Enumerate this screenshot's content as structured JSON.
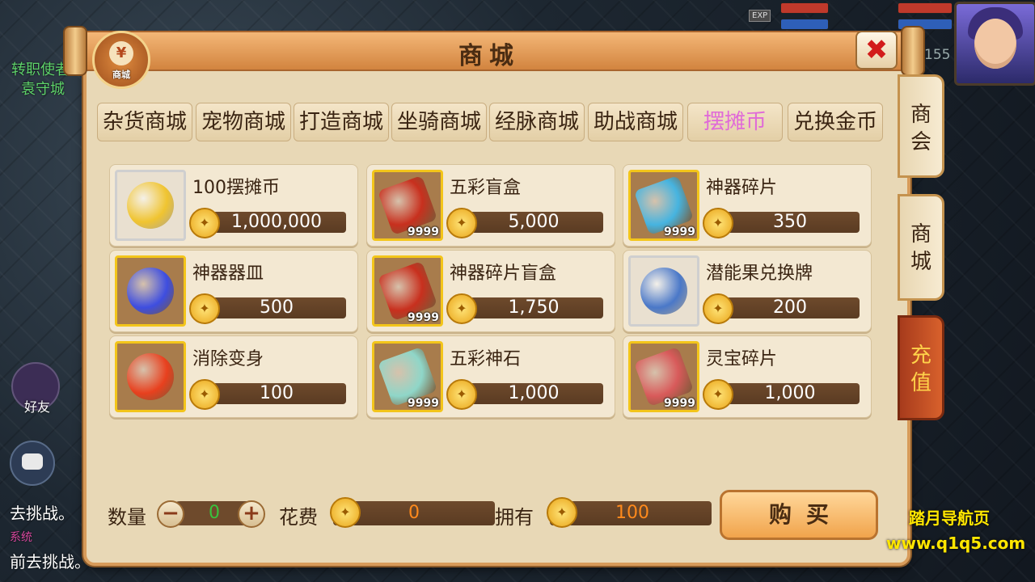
{
  "background": {
    "npc_title": "转职使者",
    "npc_place": "袁守城",
    "level": "155",
    "exp_label": "EXP",
    "friends_label": "好友",
    "chat_lines": [
      "去挑战。",
      "系统",
      "前去挑战。"
    ]
  },
  "shop": {
    "title": "商城",
    "logo_label": "商城",
    "logo_symbol": "¥",
    "close_symbol": "✖"
  },
  "tabs": [
    {
      "label": "杂货商城"
    },
    {
      "label": "宠物商城"
    },
    {
      "label": "打造商城"
    },
    {
      "label": "坐骑商城"
    },
    {
      "label": "经脉商城"
    },
    {
      "label": "助战商城"
    },
    {
      "label": "摆摊币",
      "active": true
    },
    {
      "label": "兑换金币"
    }
  ],
  "items": [
    {
      "name": "100摆摊币",
      "price": "1,000,000",
      "count": "",
      "icon": "gold-coin-icon",
      "color": "#f0c430"
    },
    {
      "name": "五彩盲盒",
      "price": "5,000",
      "count": "9999",
      "icon": "red-box-icon",
      "color": "#c8301e"
    },
    {
      "name": "神器碎片",
      "price": "350",
      "count": "9999",
      "icon": "artifact-shard-icon",
      "color": "#46b4e0"
    },
    {
      "name": "神器器皿",
      "price": "500",
      "count": "",
      "icon": "blue-orb-icon",
      "color": "#3e4ee0"
    },
    {
      "name": "神器碎片盲盒",
      "price": "1,750",
      "count": "9999",
      "icon": "red-box-icon",
      "color": "#c8301e"
    },
    {
      "name": "潜能果兑换牌",
      "price": "200",
      "count": "",
      "icon": "silver-badge-icon",
      "color": "#4a78c8"
    },
    {
      "name": "消除变身",
      "price": "100",
      "count": "",
      "icon": "red-orb-icon",
      "color": "#e8401e"
    },
    {
      "name": "五彩神石",
      "price": "1,000",
      "count": "9999",
      "icon": "crystal-icon",
      "color": "#8fd6c8"
    },
    {
      "name": "灵宝碎片",
      "price": "1,000",
      "count": "9999",
      "icon": "red-stone-icon",
      "color": "#d85a5a"
    }
  ],
  "bottom": {
    "qty_label": "数量",
    "qty_value": "0",
    "minus": "−",
    "plus": "+",
    "cost_label": "花费",
    "cost_value": "0",
    "own_label": "拥有",
    "own_value": "100",
    "buy_label": "购买"
  },
  "side_tabs": [
    {
      "label": "商会"
    },
    {
      "label": "商城"
    },
    {
      "label": "充值"
    }
  ],
  "watermark": {
    "line1": "踏月导航页",
    "line2": "www.q1q5.com"
  },
  "colors": {
    "accent": "#d79b5a",
    "active_tab": "#e06ad8",
    "qty_green": "#39c43d",
    "cost_orange": "#ff8a1c",
    "own_orange": "#ff8a1c"
  }
}
